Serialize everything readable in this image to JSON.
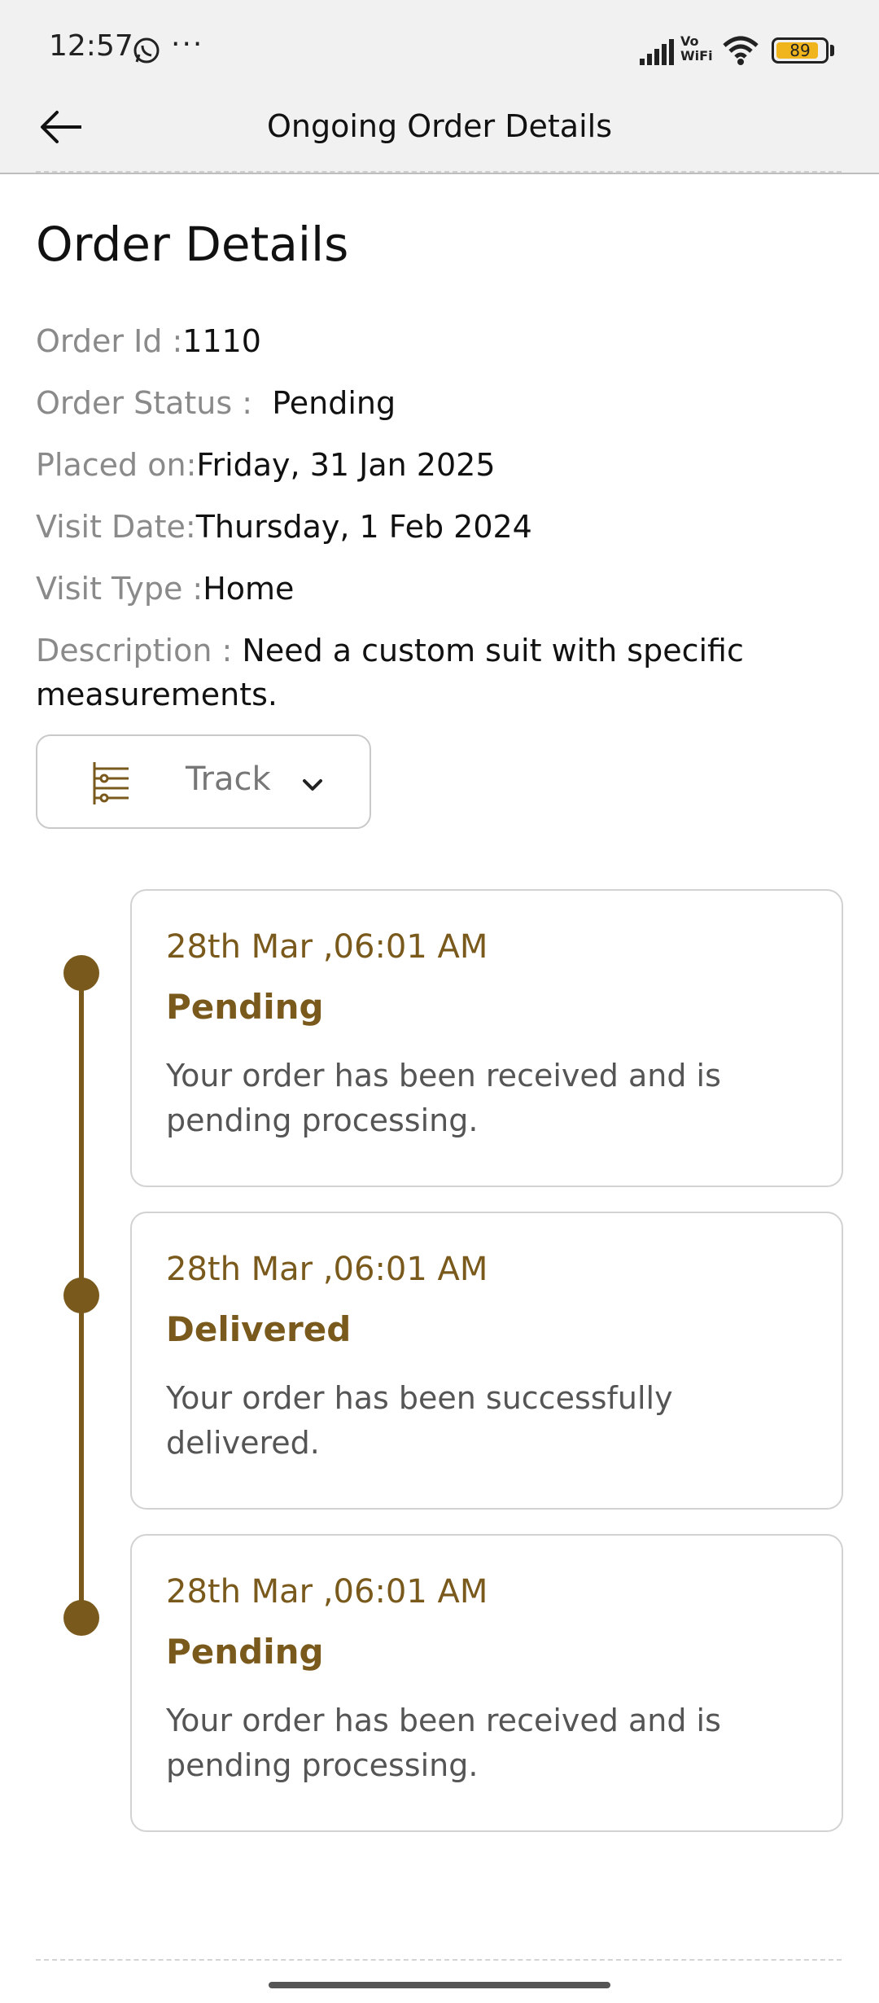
{
  "status_bar": {
    "time": "12:57",
    "dots": "···",
    "network_label_top": "Vo",
    "network_label_bottom": "WiFi",
    "battery": "89",
    "battery_level": 0.89
  },
  "header": {
    "title": "Ongoing Order Details"
  },
  "order": {
    "heading": "Order Details",
    "id_label": "Order Id :",
    "id_value": "1110",
    "status_label": "Order Status : ",
    "status_value": "Pending",
    "placed_label": "Placed on:",
    "placed_value": "Friday, 31 Jan 2025",
    "visit_date_label": "Visit Date:",
    "visit_date_value": "Thursday, 1 Feb 2024",
    "visit_type_label": "Visit Type :",
    "visit_type_value": "Home",
    "description_label": "Description : ",
    "description_value": "Need a custom suit with specific measurements."
  },
  "track": {
    "label": "Track"
  },
  "timeline": [
    {
      "date": "28th Mar ,06:01 AM",
      "status": "Pending",
      "description": "Your order has been received and is pending processing."
    },
    {
      "date": "28th Mar ,06:01 AM",
      "status": "Delivered",
      "description": "Your order has been successfully delivered."
    },
    {
      "date": "28th Mar ,06:01 AM",
      "status": "Pending",
      "description": "Your order has been received and is pending processing."
    }
  ],
  "colors": {
    "accent": "#7a5a1c",
    "header_bg": "#f1f1f1",
    "battery": "#f0b51c"
  }
}
